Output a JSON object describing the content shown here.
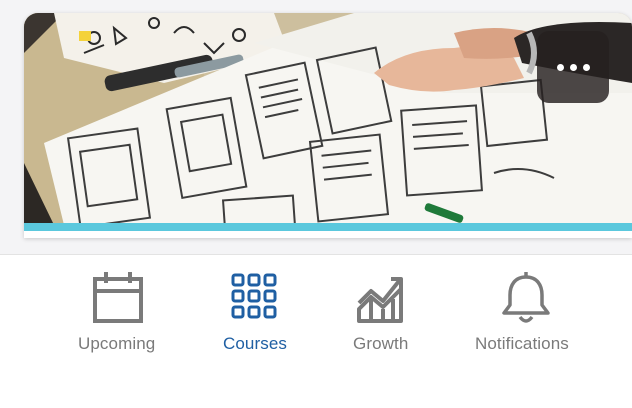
{
  "card": {
    "more_button_icon": "more-horizontal-icon",
    "accent_color": "#5bc8dd"
  },
  "tabbar": {
    "active_color": "#1f5fa3",
    "inactive_color": "#7a7a7a",
    "tabs": [
      {
        "label": "Upcoming",
        "icon": "calendar-icon",
        "active": false
      },
      {
        "label": "Courses",
        "icon": "grid-icon",
        "active": true
      },
      {
        "label": "Growth",
        "icon": "growth-chart-icon",
        "active": false
      },
      {
        "label": "Notifications",
        "icon": "bell-icon",
        "active": false
      }
    ]
  }
}
